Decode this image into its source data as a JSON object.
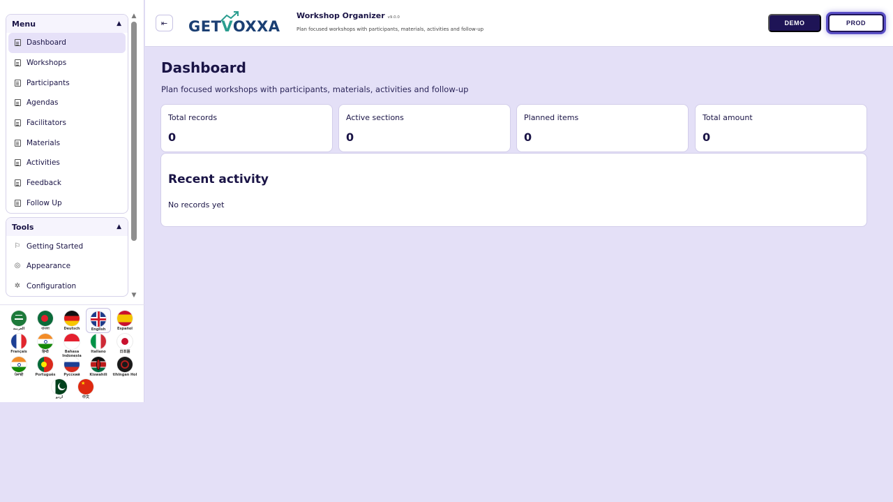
{
  "sidebar": {
    "menu": {
      "title": "Menu",
      "items": [
        {
          "label": "Dashboard"
        },
        {
          "label": "Workshops"
        },
        {
          "label": "Participants"
        },
        {
          "label": "Agendas"
        },
        {
          "label": "Facilitators"
        },
        {
          "label": "Materials"
        },
        {
          "label": "Activities"
        },
        {
          "label": "Feedback"
        },
        {
          "label": "Follow Up"
        }
      ],
      "active_index": 0
    },
    "tools": {
      "title": "Tools",
      "items": [
        {
          "label": "Getting Started",
          "icon": "flag-icon"
        },
        {
          "label": "Appearance",
          "icon": "palette-icon"
        },
        {
          "label": "Configuration",
          "icon": "gear-icon"
        }
      ]
    },
    "languages": [
      {
        "label": "العربية",
        "icon": "flag-saudi-arabia-icon"
      },
      {
        "label": "বাংলা",
        "icon": "flag-bangladesh-icon"
      },
      {
        "label": "Deutsch",
        "icon": "flag-germany-icon"
      },
      {
        "label": "English",
        "icon": "flag-uk-icon",
        "selected": true
      },
      {
        "label": "Español",
        "icon": "flag-spain-icon"
      },
      {
        "label": "Français",
        "icon": "flag-france-icon"
      },
      {
        "label": "हिन्दी",
        "icon": "flag-india-icon"
      },
      {
        "label": "Bahasa Indonesia",
        "icon": "flag-indonesia-icon"
      },
      {
        "label": "Italiano",
        "icon": "flag-italy-icon"
      },
      {
        "label": "日本語",
        "icon": "flag-japan-icon"
      },
      {
        "label": "ਪੰਜਾਬੀ",
        "icon": "flag-india-icon"
      },
      {
        "label": "Português",
        "icon": "flag-portugal-icon"
      },
      {
        "label": "Русский",
        "icon": "flag-russia-icon"
      },
      {
        "label": "Kiswahili",
        "icon": "flag-kenya-icon"
      },
      {
        "label": "tlhIngan Hol",
        "icon": "flag-klingon-icon"
      },
      {
        "label": "اردو",
        "icon": "flag-pakistan-icon"
      },
      {
        "label": "中文",
        "icon": "flag-china-icon"
      }
    ]
  },
  "header": {
    "logo_text_a": "GET",
    "logo_text_b": "V",
    "logo_text_c": "OXXA",
    "app_title": "Workshop Organizer",
    "version": "v9.0.0",
    "subtitle": "Plan focused workshops with participants, materials, activities and follow-up",
    "demo_label": "DEMO",
    "prod_label": "PROD"
  },
  "main": {
    "title": "Dashboard",
    "subtitle": "Plan focused workshops with participants, materials, activities and follow-up",
    "stats": [
      {
        "label": "Total records",
        "value": "0"
      },
      {
        "label": "Active sections",
        "value": "0"
      },
      {
        "label": "Planned items",
        "value": "0"
      },
      {
        "label": "Total amount",
        "value": "0"
      }
    ],
    "recent": {
      "title": "Recent activity",
      "empty": "No records yet"
    }
  },
  "colors": {
    "background": "#e4e0f7",
    "primary": "#1e1456",
    "accent": "#5a4fc6"
  }
}
